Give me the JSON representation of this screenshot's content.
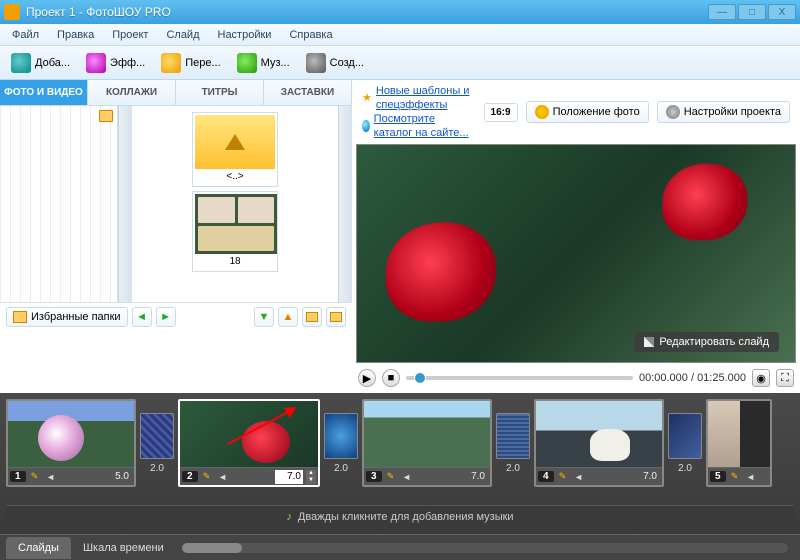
{
  "title": "Проект 1 - ФотоШОУ PRO",
  "menu": [
    "Файл",
    "Правка",
    "Проект",
    "Слайд",
    "Настройки",
    "Справка"
  ],
  "toolbar": [
    {
      "label": "Доба...",
      "icon": "ic-cam",
      "name": "add-button"
    },
    {
      "label": "Эфф...",
      "icon": "ic-eff",
      "name": "effects-button"
    },
    {
      "label": "Пере...",
      "icon": "ic-star",
      "name": "transitions-button"
    },
    {
      "label": "Муз...",
      "icon": "ic-mus",
      "name": "music-button"
    },
    {
      "label": "Созд...",
      "icon": "ic-crt",
      "name": "create-button"
    }
  ],
  "links": {
    "l1": "Новые шаблоны и спецэффекты",
    "l2": "Посмотрите каталог на сайте..."
  },
  "options": {
    "ratio": "16:9",
    "pos": "Положение фото",
    "settings": "Настройки проекта"
  },
  "tabs": [
    "ФОТО И ВИДЕО",
    "КОЛЛАЖИ",
    "ТИТРЫ",
    "ЗАСТАВКИ"
  ],
  "thumbs": {
    "up": "<..>",
    "folder": "18"
  },
  "fav": "Избранные папки",
  "preview": {
    "edit": "Редактировать слайд"
  },
  "time": {
    "cur": "00:00.000",
    "sep": " / ",
    "total": "01:25.000"
  },
  "slides": [
    {
      "n": "1",
      "dur": "5.0",
      "cls": "s1"
    },
    {
      "n": "2",
      "dur": "7.0",
      "cls": "s2",
      "sel": true,
      "edit": true
    },
    {
      "n": "3",
      "dur": "7.0",
      "cls": "s3"
    },
    {
      "n": "4",
      "dur": "7.0",
      "cls": "s4"
    },
    {
      "n": "5",
      "dur": "",
      "cls": "s5"
    }
  ],
  "trans": [
    {
      "dur": "2.0",
      "cls": "t1"
    },
    {
      "dur": "2.0",
      "cls": "t2"
    },
    {
      "dur": "2.0",
      "cls": "t3"
    },
    {
      "dur": "2.0",
      "cls": "t4"
    }
  ],
  "music": "Дважды кликните для добавления музыки",
  "btabs": {
    "a": "Слайды",
    "b": "Шкала времени"
  }
}
